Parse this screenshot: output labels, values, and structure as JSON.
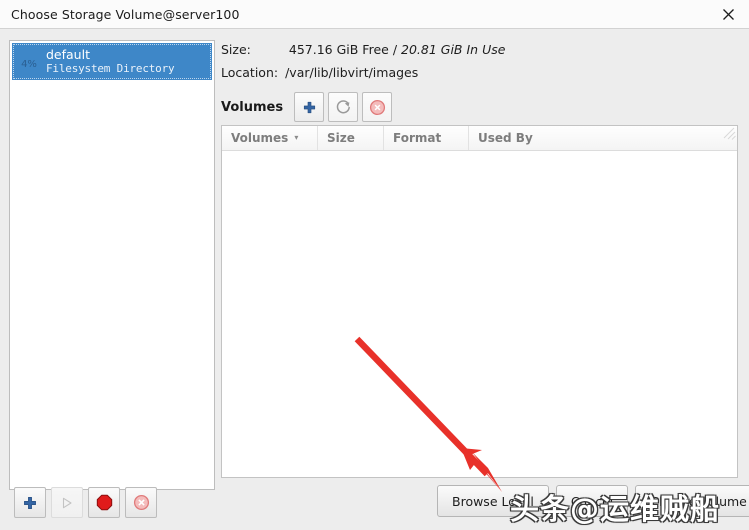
{
  "window": {
    "title": "Choose Storage Volume@server100",
    "close_icon": "close-icon"
  },
  "pool_list": {
    "items": [
      {
        "percent": "4%",
        "name": "default",
        "subtitle": "Filesystem Directory"
      }
    ]
  },
  "pool_buttons": [
    {
      "name": "add-pool-button",
      "icon": "plus-icon",
      "enabled": true
    },
    {
      "name": "start-pool-button",
      "icon": "play-icon",
      "enabled": false
    },
    {
      "name": "stop-pool-button",
      "icon": "stop-icon",
      "enabled": true
    },
    {
      "name": "delete-pool-button",
      "icon": "delete-circle-icon",
      "enabled": true
    }
  ],
  "details": {
    "size_label": "Size:",
    "size_free": "457.16 GiB Free",
    "size_separator": "/",
    "size_in_use": "20.81 GiB In Use",
    "location_label": "Location:",
    "location_value": "/var/lib/libvirt/images"
  },
  "volumes": {
    "title": "Volumes",
    "toolbar": [
      {
        "name": "new-volume-button",
        "icon": "plus-icon"
      },
      {
        "name": "refresh-volumes-button",
        "icon": "refresh-icon"
      },
      {
        "name": "delete-volume-button",
        "icon": "delete-circle-icon"
      }
    ],
    "columns": [
      {
        "label": "Volumes",
        "sorted": true,
        "caret": "▾"
      },
      {
        "label": "Size",
        "sorted": false
      },
      {
        "label": "Format",
        "sorted": false
      },
      {
        "label": "Used By",
        "sorted": false
      }
    ],
    "rows": []
  },
  "actions": [
    {
      "name": "browse-local-button",
      "label": "Browse Local"
    },
    {
      "name": "cancel-button",
      "label": "Cancel"
    },
    {
      "name": "choose-volume-button",
      "label": "Choose Volume"
    }
  ],
  "annotation": {
    "arrow_color": "#e8312a",
    "arrow_from": "358,340",
    "arrow_to": "500,489",
    "target": "browse-local-button"
  },
  "watermark": {
    "text": "头条@运维贼船"
  }
}
